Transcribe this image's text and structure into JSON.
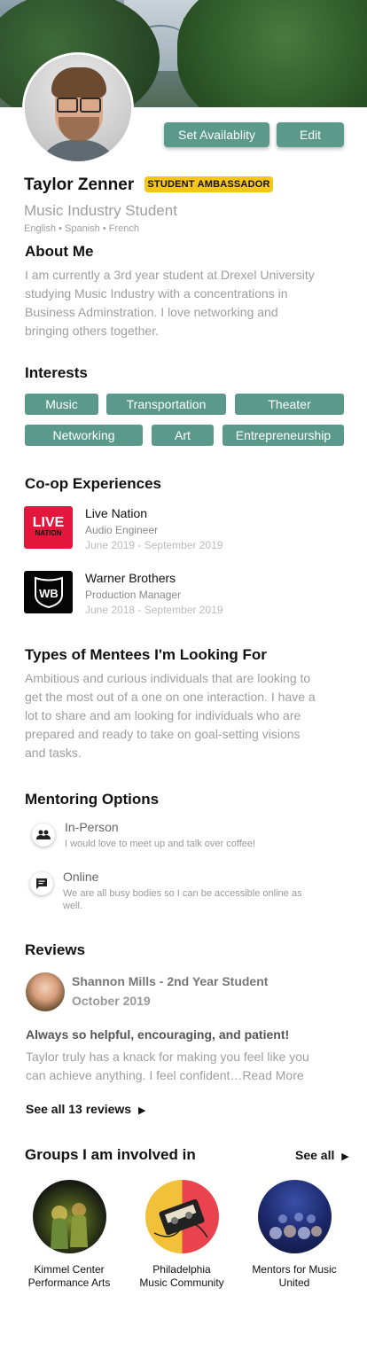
{
  "profile": {
    "name": "Taylor Zenner",
    "badge": "STUDENT AMBASSADOR",
    "subtitle": "Music Industry Student",
    "languages": "English • Spanish • French",
    "set_availability_label": "Set Availablity",
    "edit_label": "Edit"
  },
  "about": {
    "heading": "About Me",
    "lines": [
      "I am currently a 3rd year student at Drexel University",
      "studying Music Industry with a concentrations in",
      "Business Adminstration. I love networking and",
      "bringing others together."
    ]
  },
  "interests": {
    "heading": "Interests",
    "items": [
      "Music",
      "Transportation",
      "Theater",
      "Networking",
      "Art",
      "Entrepreneurship"
    ]
  },
  "coop": {
    "heading": "Co-op Experiences",
    "items": [
      {
        "company": "Live Nation",
        "role": "Audio Engineer",
        "dates": "June 2019 - September 2019",
        "logo_top": "LIVE",
        "logo_bottom": "NATION"
      },
      {
        "company": "Warner Brothers",
        "role": "Production Manager",
        "dates": "June 2018 - September 2019",
        "logo_text": "WB"
      }
    ]
  },
  "mentees": {
    "heading": "Types of Mentees I'm Looking For",
    "lines": [
      "Ambitious and curious individuals that are looking to",
      "get the most out of a one on one interaction. I have a",
      "lot to share and am looking for individuals who are",
      "prepared and ready to take on goal-setting visions",
      "and tasks."
    ]
  },
  "mentoring": {
    "heading": "Mentoring Options",
    "options": [
      {
        "title": "In-Person",
        "desc": "I would love to meet up and talk over coffee!",
        "icon": "people-icon"
      },
      {
        "title": "Online",
        "desc_lines": [
          "We are all busy bodies so I can be accessible online as",
          "well."
        ],
        "icon": "chat-icon"
      }
    ]
  },
  "reviews": {
    "heading": "Reviews",
    "reviewer": "Shannon Mills - 2nd Year Student",
    "date": "October 2019",
    "headline": "Always so helpful, encouraging, and patient!",
    "body_line1": "Taylor truly has a knack for making you feel like you",
    "body_line2": "can achieve anything. I feel confident…",
    "read_more": "Read More",
    "see_all": "See all 13 reviews"
  },
  "groups": {
    "heading": "Groups I am involved in",
    "see_all": "See all",
    "items": [
      {
        "line1": "Kimmel Center",
        "line2": "Performance Arts"
      },
      {
        "line1": "Philadelphia",
        "line2": "Music Community"
      },
      {
        "line1": "Mentors for Music",
        "line2": "United"
      }
    ]
  },
  "colors": {
    "accent": "#5b9a8b",
    "badge": "#f5c518",
    "muted": "#9e9e9e"
  }
}
